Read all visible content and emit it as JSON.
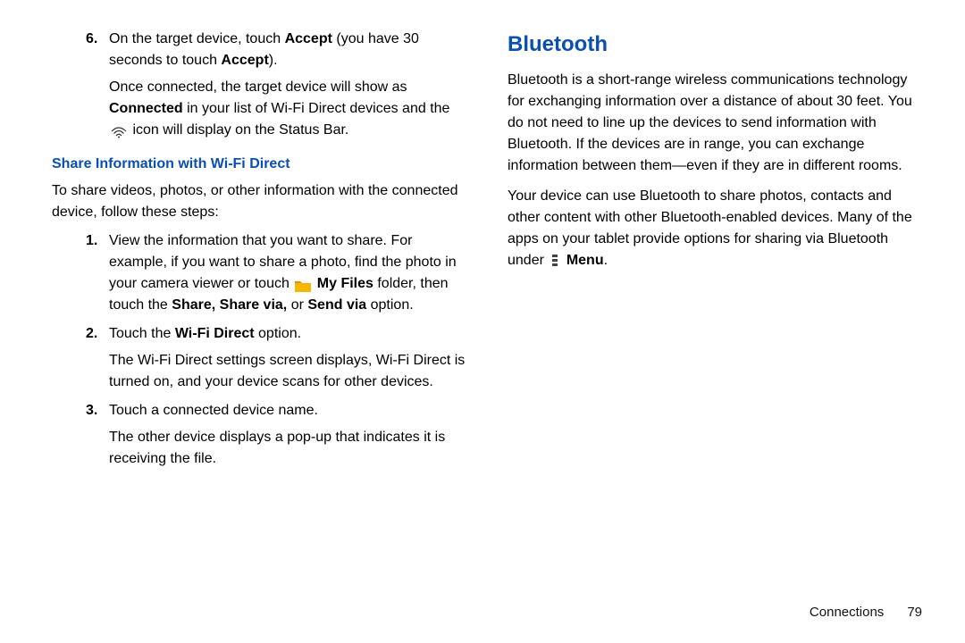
{
  "left": {
    "item6_num": "6.",
    "item6_a": "On the target device, touch ",
    "item6_b": "Accept",
    "item6_c": " (you have 30 seconds to touch ",
    "item6_d": "Accept",
    "item6_e": ").",
    "item6_f1": "Once connected, the target device will show as ",
    "item6_f2": "Connected",
    "item6_f3": " in your list of Wi-Fi Direct devices and the ",
    "item6_f4": " icon will display on the Status Bar.",
    "sub_heading": "Share Information with Wi-Fi Direct",
    "share_intro": "To share videos, photos, or other information with the connected device, follow these steps:",
    "s1_num": "1.",
    "s1_a": "View the information that you want to share. For example, if you want to share a photo, find the photo in your camera viewer or touch ",
    "s1_b": "My Files",
    "s1_c": " folder, then touch the ",
    "s1_d": "Share, Share via,",
    "s1_e": " or ",
    "s1_f": "Send via",
    "s1_g": " option.",
    "s2_num": "2.",
    "s2_a": "Touch the ",
    "s2_b": "Wi-Fi Direct",
    "s2_c": " option.",
    "s2_d": "The Wi-Fi Direct settings screen displays, Wi-Fi Direct is turned on, and your device scans for other devices.",
    "s3_num": "3.",
    "s3_a": "Touch a connected device name.",
    "s3_b": "The other device displays a pop-up that indicates it is receiving the file."
  },
  "right": {
    "heading": "Bluetooth",
    "p1": "Bluetooth is a short-range wireless communications technology for exchanging information over a distance of about 30 feet. You do not need to line up the devices to send information with Bluetooth. If the devices are in range, you can exchange information between them—even if they are in different rooms.",
    "p2a": "Your device can use Bluetooth to share photos, contacts and other content with other Bluetooth-enabled devices. Many of the apps on your tablet provide options for sharing via Bluetooth under ",
    "p2b": "Menu",
    "p2c": "."
  },
  "footer": {
    "section": "Connections",
    "page": "79"
  }
}
